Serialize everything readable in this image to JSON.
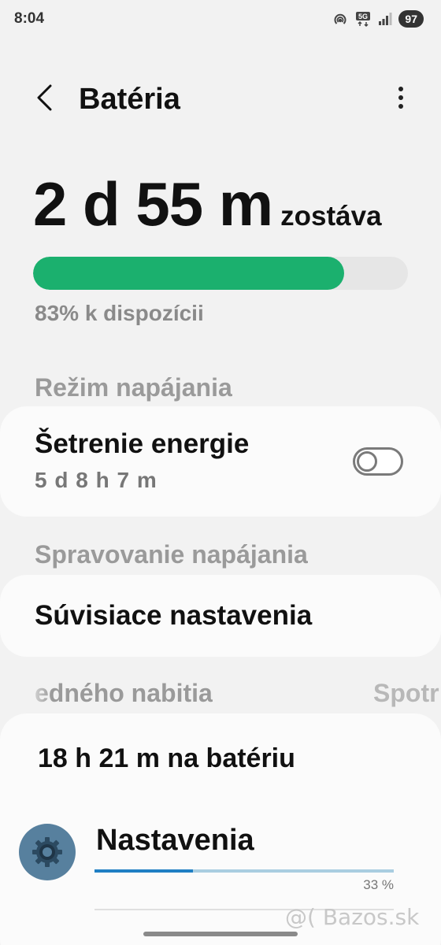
{
  "status_bar": {
    "time": "8:04",
    "network": "5G",
    "battery_level": "97"
  },
  "header": {
    "title": "Batéria"
  },
  "battery": {
    "remaining_value": "2 d 55 m",
    "remaining_suffix": "zostáva",
    "percent_fraction": 0.83,
    "available_text": "83% k dispozícii",
    "bar_color": "#1bb06e"
  },
  "power_mode": {
    "header": "Režim napájania",
    "item_title": "Šetrenie energie",
    "item_subtitle": "5 d 8 h 7 m",
    "toggle_on": false
  },
  "power_management": {
    "header": "Spravovanie napájania",
    "related_settings": "Súvisiace nastavenia"
  },
  "usage_tabs": {
    "left_tab": "edného nabitia",
    "right_tab": "Spotr"
  },
  "usage": {
    "summary": "18 h 21 m na batériu",
    "apps": [
      {
        "name": "Nastavenia",
        "icon": "gear-icon",
        "percent_fraction": 0.33,
        "percent_label": "33 %"
      }
    ]
  },
  "watermark": "@( Bazos.sk"
}
